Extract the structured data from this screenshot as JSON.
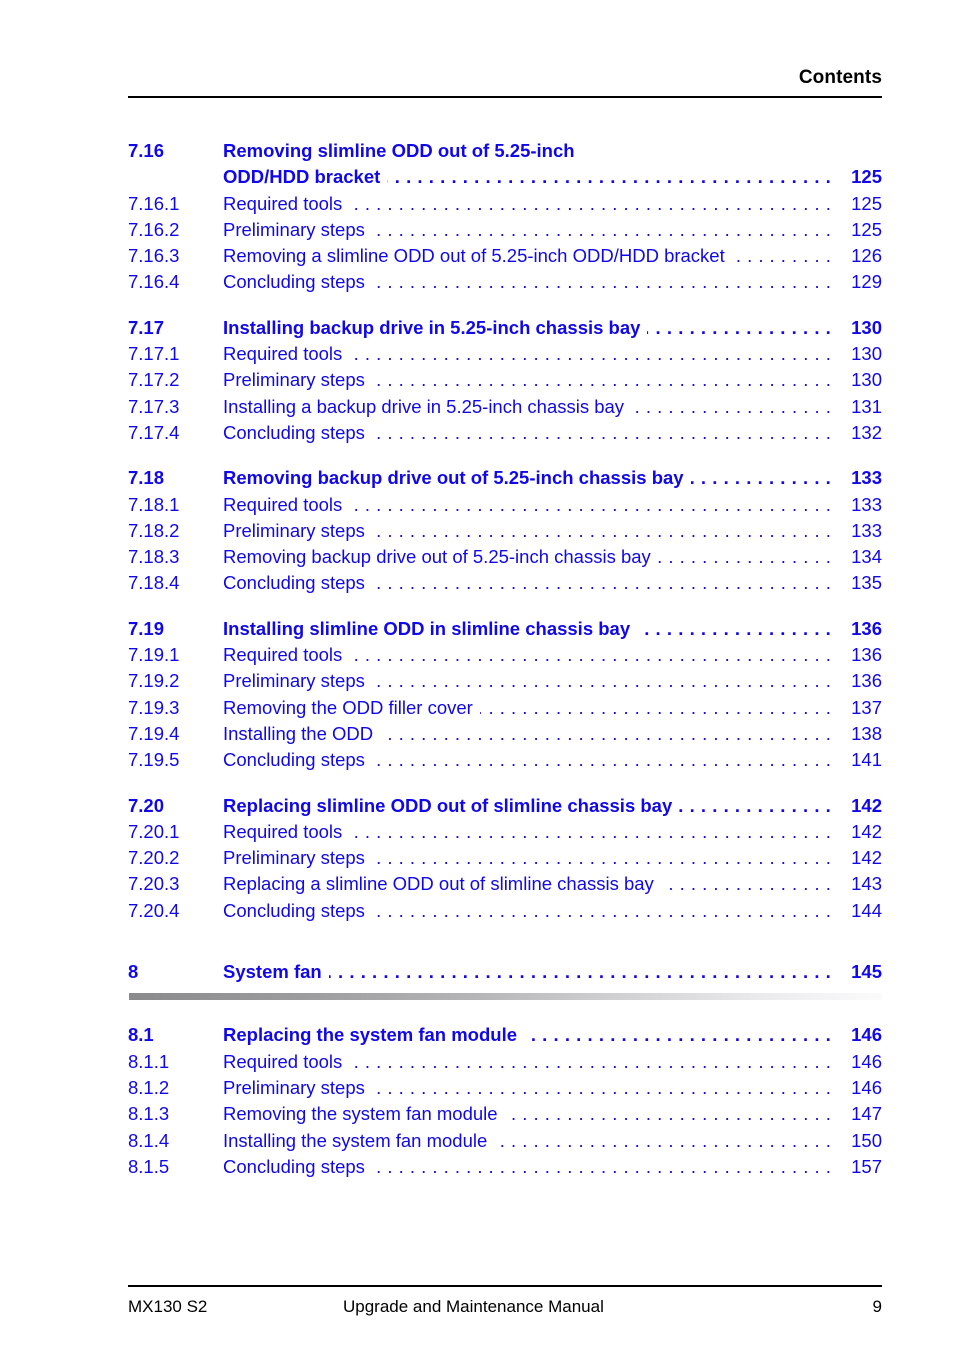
{
  "header": {
    "title": "Contents"
  },
  "toc": {
    "groups": [
      {
        "id": "group-7-16",
        "entries": [
          {
            "level": 1,
            "number": "7.16",
            "title": "Removing slimline ODD out of 5.25-inch",
            "page": "",
            "wrap": true
          },
          {
            "level": 1,
            "number": "",
            "title": "ODD/HDD bracket",
            "page": "125",
            "continuation": true
          },
          {
            "level": 2,
            "number": "7.16.1",
            "title": "Required tools",
            "page": "125"
          },
          {
            "level": 2,
            "number": "7.16.2",
            "title": "Preliminary steps",
            "page": "125"
          },
          {
            "level": 2,
            "number": "7.16.3",
            "title": "Removing a slimline ODD out of 5.25-inch ODD/HDD bracket",
            "page": "126"
          },
          {
            "level": 2,
            "number": "7.16.4",
            "title": "Concluding steps",
            "page": "129"
          }
        ]
      },
      {
        "id": "group-7-17",
        "entries": [
          {
            "level": 1,
            "number": "7.17",
            "title": "Installing backup drive in 5.25-inch chassis bay",
            "page": "130"
          },
          {
            "level": 2,
            "number": "7.17.1",
            "title": "Required tools",
            "page": "130"
          },
          {
            "level": 2,
            "number": "7.17.2",
            "title": "Preliminary steps",
            "page": "130"
          },
          {
            "level": 2,
            "number": "7.17.3",
            "title": "Installing a backup drive in 5.25-inch chassis bay",
            "page": "131"
          },
          {
            "level": 2,
            "number": "7.17.4",
            "title": "Concluding steps",
            "page": "132"
          }
        ]
      },
      {
        "id": "group-7-18",
        "entries": [
          {
            "level": 1,
            "number": "7.18",
            "title": "Removing backup drive out of 5.25-inch chassis bay",
            "page": "133"
          },
          {
            "level": 2,
            "number": "7.18.1",
            "title": "Required tools",
            "page": "133"
          },
          {
            "level": 2,
            "number": "7.18.2",
            "title": "Preliminary steps",
            "page": "133"
          },
          {
            "level": 2,
            "number": "7.18.3",
            "title": "Removing backup drive out of 5.25-inch chassis bay",
            "page": "134"
          },
          {
            "level": 2,
            "number": "7.18.4",
            "title": "Concluding steps",
            "page": "135"
          }
        ]
      },
      {
        "id": "group-7-19",
        "entries": [
          {
            "level": 1,
            "number": "7.19",
            "title": "Installing slimline ODD in slimline chassis bay",
            "page": "136"
          },
          {
            "level": 2,
            "number": "7.19.1",
            "title": "Required tools",
            "page": "136"
          },
          {
            "level": 2,
            "number": "7.19.2",
            "title": "Preliminary steps",
            "page": "136"
          },
          {
            "level": 2,
            "number": "7.19.3",
            "title": "Removing the ODD filler cover",
            "page": "137"
          },
          {
            "level": 2,
            "number": "7.19.4",
            "title": "Installing the ODD",
            "page": "138"
          },
          {
            "level": 2,
            "number": "7.19.5",
            "title": "Concluding steps",
            "page": "141"
          }
        ]
      },
      {
        "id": "group-7-20",
        "entries": [
          {
            "level": 1,
            "number": "7.20",
            "title": "Replacing slimline ODD out of slimline chassis bay",
            "page": "142"
          },
          {
            "level": 2,
            "number": "7.20.1",
            "title": "Required tools",
            "page": "142"
          },
          {
            "level": 2,
            "number": "7.20.2",
            "title": "Preliminary steps",
            "page": "142"
          },
          {
            "level": 2,
            "number": "7.20.3",
            "title": "Replacing a slimline ODD out of slimline chassis bay",
            "page": "143"
          },
          {
            "level": 2,
            "number": "7.20.4",
            "title": "Concluding steps",
            "page": "144"
          }
        ]
      }
    ],
    "chapter": {
      "id": "chapter-8",
      "number": "8",
      "title": "System fan",
      "page": "145"
    },
    "chapter_groups": [
      {
        "id": "group-8-1",
        "entries": [
          {
            "level": 1,
            "number": "8.1",
            "title": "Replacing the system fan module",
            "page": "146"
          },
          {
            "level": 2,
            "number": "8.1.1",
            "title": "Required tools",
            "page": "146"
          },
          {
            "level": 2,
            "number": "8.1.2",
            "title": "Preliminary steps",
            "page": "146"
          },
          {
            "level": 2,
            "number": "8.1.3",
            "title": "Removing the system fan module",
            "page": "147"
          },
          {
            "level": 2,
            "number": "8.1.4",
            "title": "Installing the system fan module",
            "page": "150"
          },
          {
            "level": 2,
            "number": "8.1.5",
            "title": "Concluding steps",
            "page": "157"
          }
        ]
      }
    ]
  },
  "footer": {
    "product": "MX130 S2",
    "document_title": "Upgrade and Maintenance Manual",
    "page_number": "9"
  },
  "colors": {
    "link_blue": "#1008e8",
    "text_black": "#000000",
    "rule_gray_start": "#8a8a8d",
    "rule_gray_end": "#fbfbfc"
  }
}
